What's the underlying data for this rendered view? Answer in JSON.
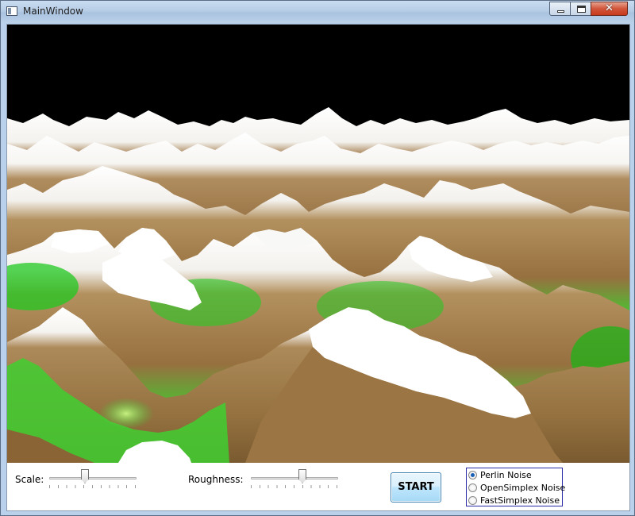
{
  "window": {
    "title": "MainWindow",
    "close_glyph": "✕",
    "app_icon": "window-icon"
  },
  "scene": {
    "sky_color": "#000000",
    "snow_color": "#ffffff",
    "rock_color": "#a07a45",
    "grass_color": "#22d022"
  },
  "controls": {
    "scale_label": "Scale:",
    "scale_value": 0.4,
    "roughness_label": "Roughness:",
    "roughness_value": 0.6,
    "start_label": "START",
    "noise_options": [
      {
        "label": "Perlin Noise",
        "checked": true
      },
      {
        "label": "OpenSimplex Noise",
        "checked": false
      },
      {
        "label": "FastSimplex Noise",
        "checked": false
      }
    ]
  }
}
